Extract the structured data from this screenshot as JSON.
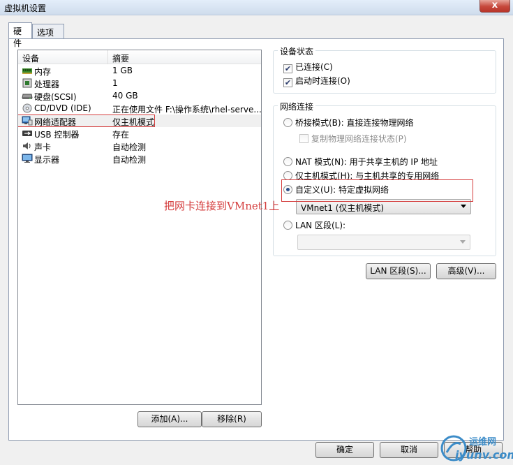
{
  "window": {
    "title": "虚拟机设置",
    "close_label": "x"
  },
  "tabs": [
    {
      "label": "硬件",
      "active": true
    },
    {
      "label": "选项",
      "active": false
    }
  ],
  "device_list": {
    "columns": [
      "设备",
      "摘要"
    ],
    "rows": [
      {
        "name": "内存",
        "summary": "1 GB",
        "icon": "memory-icon"
      },
      {
        "name": "处理器",
        "summary": "1",
        "icon": "processor-icon"
      },
      {
        "name": "硬盘(SCSI)",
        "summary": "40 GB",
        "icon": "hard-disk-icon"
      },
      {
        "name": "CD/DVD (IDE)",
        "summary": "正在使用文件 F:\\操作系统\\rhel-serve...",
        "icon": "cd-dvd-icon"
      },
      {
        "name": "网络适配器",
        "summary": "仅主机模式",
        "icon": "network-adapter-icon",
        "selected": true
      },
      {
        "name": "USB 控制器",
        "summary": "存在",
        "icon": "usb-icon"
      },
      {
        "name": "声卡",
        "summary": "自动检测",
        "icon": "sound-card-icon"
      },
      {
        "name": "显示器",
        "summary": "自动检测",
        "icon": "display-icon"
      }
    ]
  },
  "buttons": {
    "add": "添加(A)...",
    "remove": "移除(R)",
    "lan_segments": "LAN 区段(S)...",
    "advanced": "高级(V)...",
    "ok": "确定",
    "cancel": "取消",
    "help": "帮助"
  },
  "device_status": {
    "title": "设备状态",
    "connected": {
      "label": "已连接(C)",
      "checked": true
    },
    "connect_at_power_on": {
      "label": "启动时连接(O)",
      "checked": true
    }
  },
  "network_connection": {
    "title": "网络连接",
    "bridged": {
      "label": "桥接模式(B): 直接连接物理网络",
      "selected": false
    },
    "replicate": {
      "label": "复制物理网络连接状态(P)",
      "checked": false
    },
    "nat": {
      "label": "NAT 模式(N): 用于共享主机的 IP 地址",
      "selected": false
    },
    "host_only": {
      "label": "仅主机模式(H): 与主机共享的专用网络",
      "selected": false
    },
    "custom": {
      "label": "自定义(U): 特定虚拟网络",
      "selected": true
    },
    "custom_network_value": "VMnet1 (仅主机模式)",
    "lan_segment": {
      "label": "LAN 区段(L):",
      "selected": false
    },
    "lan_segment_value": ""
  },
  "annotation": {
    "text": "把网卡连接到VMnet1上"
  },
  "watermark": {
    "text": "运维网",
    "url": "iyunv.com"
  },
  "colors": {
    "annotation_red": "#d43c3c",
    "radio_dot": "#2d4f8a",
    "watermark_blue": "#3c8cc8"
  }
}
